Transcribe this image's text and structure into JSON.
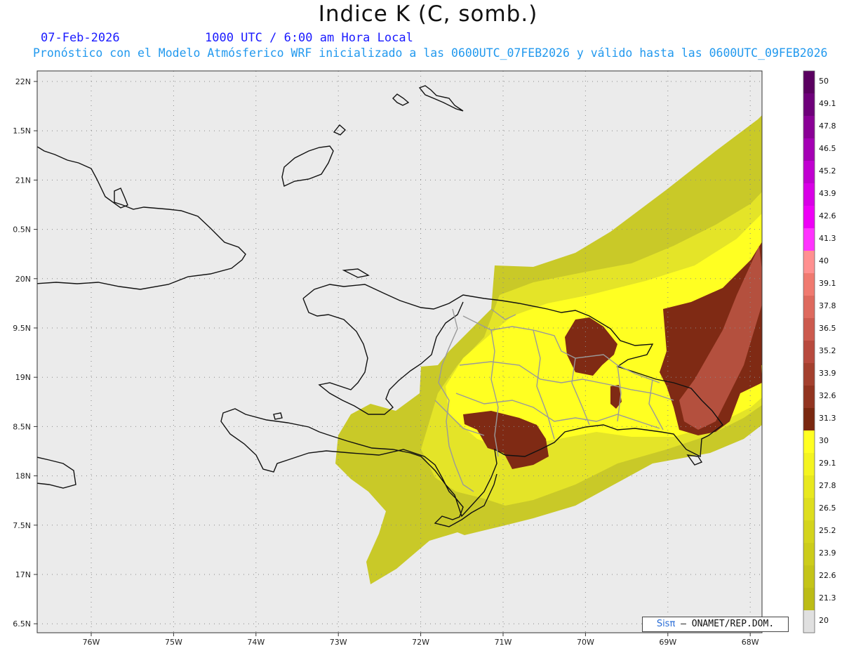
{
  "header": {
    "title": "Indice K (C, somb.)",
    "date": "07-Feb-2026",
    "time": "1000 UTC / 6:00 am Hora Local",
    "description": "Pronóstico con el Modelo Atmósferico WRF inicializado a las 0600UTC_07FEB2026 y válido hasta las  0600UTC_09FEB2026"
  },
  "map": {
    "lat_labels": [
      "22N",
      "1.5N",
      "21N",
      "0.5N",
      "20N",
      "9.5N",
      "19N",
      "8.5N",
      "18N",
      "7.5N",
      "17N",
      "6.5N"
    ],
    "lon_labels": [
      "76W",
      "75W",
      "74W",
      "73W",
      "72W",
      "71W",
      "70W",
      "69W",
      "68W"
    ],
    "colors": {
      "background": "#ebebeb",
      "grid": "#8a8a8a",
      "coast": "#111111",
      "provinces": "#9a9a9a"
    }
  },
  "colorbar": {
    "labels": [
      "50",
      "49.1",
      "47.8",
      "46.5",
      "45.2",
      "43.9",
      "42.6",
      "41.3",
      "40",
      "39.1",
      "37.8",
      "36.5",
      "35.2",
      "33.9",
      "32.6",
      "31.3",
      "30",
      "29.1",
      "27.8",
      "26.5",
      "25.2",
      "23.9",
      "22.6",
      "21.3",
      "20"
    ],
    "colors": [
      "#5a0060",
      "#6e007a",
      "#8a0096",
      "#a400b4",
      "#c000d0",
      "#d800e6",
      "#ee00f6",
      "#ff33ff",
      "#ff9090",
      "#f07a70",
      "#de6a5e",
      "#cc5a4e",
      "#b84a3e",
      "#a4402e",
      "#923420",
      "#7a2810",
      "#ffff22",
      "#f4f420",
      "#e8e81e",
      "#dede1e",
      "#d4d41c",
      "#cccc1a",
      "#c4c418",
      "#bcbc16",
      "#e0e0e0"
    ]
  },
  "credit": {
    "brand": "Sisπ",
    "text": " – ONAMET/REP.DOM."
  }
}
